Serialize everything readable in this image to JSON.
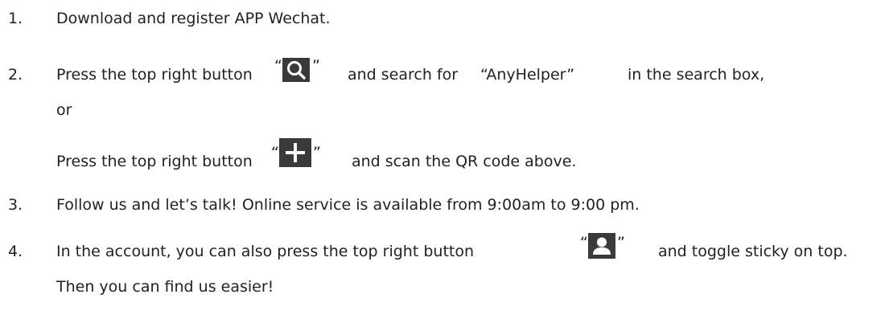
{
  "steps": [
    {
      "number": "1.",
      "text": "Download and register APP Wechat."
    },
    {
      "number": "2.",
      "text_before": "Press the top right button",
      "icon_name": "search-icon",
      "text_after_1": "and search for",
      "keyword": "“AnyHelper”",
      "text_after_2": "in the search box,",
      "continuation": "or",
      "alt_text_before": "Press the top right button",
      "alt_icon_name": "plus-icon",
      "alt_text_after": "and scan the QR code above."
    },
    {
      "number": "3.",
      "text": "Follow us and let’s talk! Online service is available from 9:00am to 9:00 pm."
    },
    {
      "number": "4.",
      "text_before": "In the account, you can also press the top right button",
      "icon_name": "person-icon",
      "text_after": "and toggle sticky on top.",
      "continuation": "Then you can find us easier!"
    }
  ],
  "quote_open": "“",
  "quote_close": "”",
  "colors": {
    "text": "#222222",
    "icon_bg": "#3a3a3a",
    "icon_fg": "#ffffff"
  }
}
